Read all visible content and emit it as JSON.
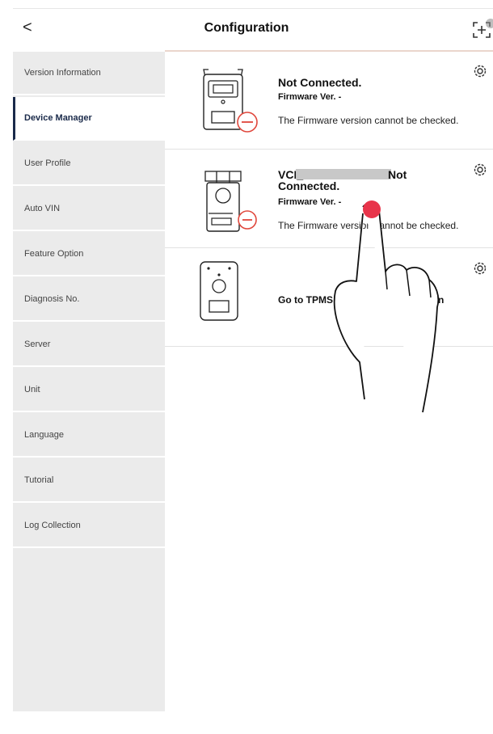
{
  "header": {
    "back_label": "<",
    "title": "Configuration",
    "scan_icon": "scan-add-icon"
  },
  "sidebar": {
    "items": [
      {
        "label": "Version Information"
      },
      {
        "label": "Device Manager",
        "active": true
      },
      {
        "label": "User Profile"
      },
      {
        "label": "Auto VIN"
      },
      {
        "label": "Feature Option"
      },
      {
        "label": "Diagnosis No."
      },
      {
        "label": "Server"
      },
      {
        "label": "Unit"
      },
      {
        "label": "Language"
      },
      {
        "label": "Tutorial"
      },
      {
        "label": "Log Collection"
      }
    ]
  },
  "devices": [
    {
      "name": "Not Connected.",
      "firmware": "Firmware Ver. -",
      "message": "The Firmware version cannot be checked.",
      "icon": "vci-device-disconnected-icon"
    },
    {
      "name_prefix": "VCI_",
      "name_suffix": "Not",
      "name_line2": "Connected.",
      "firmware": "Firmware Ver. -",
      "message": "The Firmware version cannot be checked.",
      "icon": "vci-pro-device-disconnected-icon"
    },
    {
      "name": "Go to TPMS",
      "name_end": "n",
      "icon": "tpms-device-icon"
    }
  ],
  "colors": {
    "accent": "#1a2a4a",
    "disconnected": "#e0473c",
    "touch": "#e8344a",
    "sidebar_bg": "#ebebeb"
  }
}
